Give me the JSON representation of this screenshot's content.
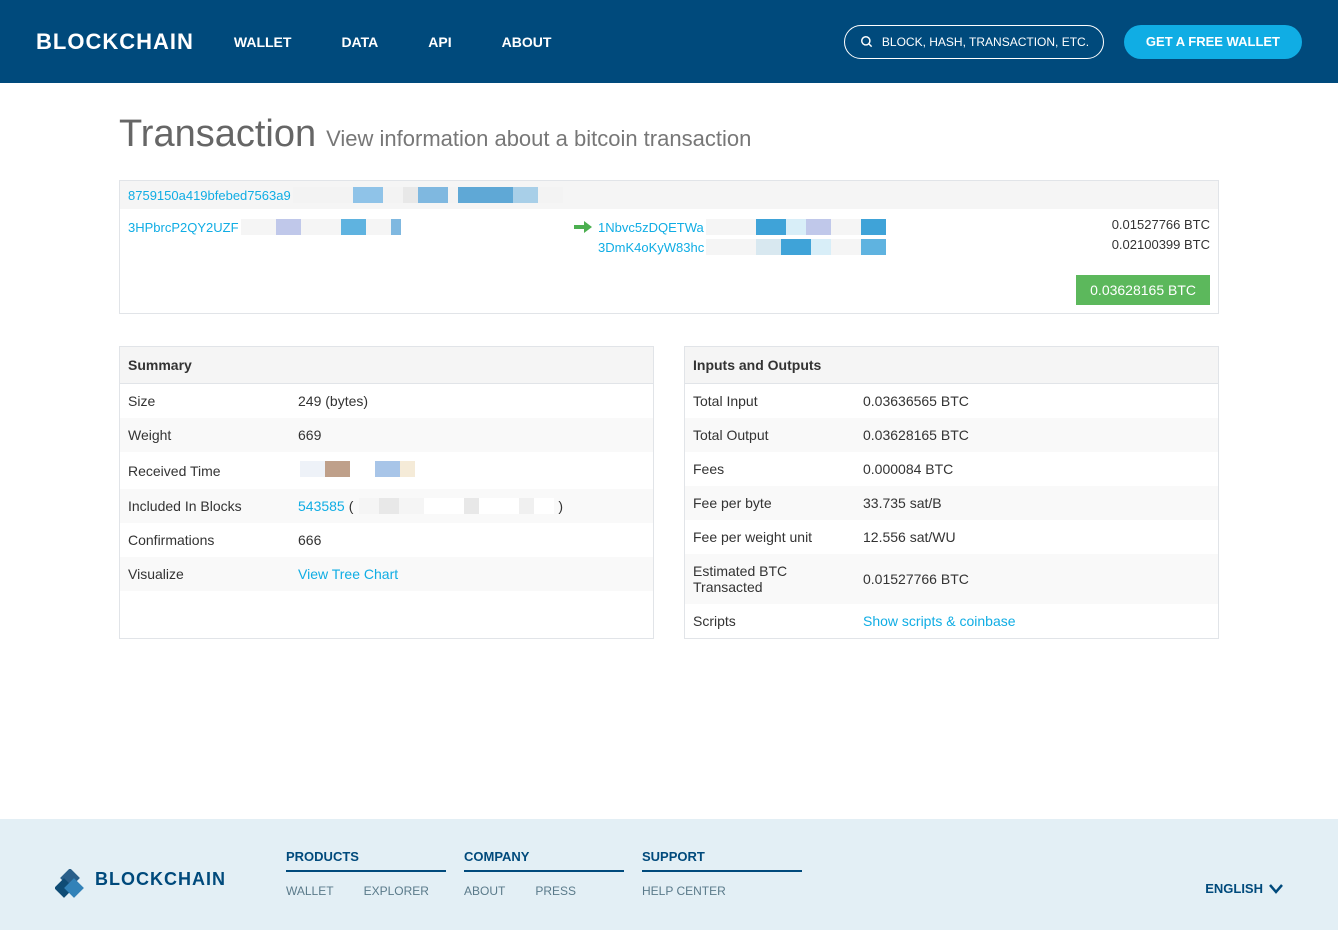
{
  "header": {
    "logo": "BLOCKCHAIN",
    "nav": [
      "WALLET",
      "DATA",
      "API",
      "ABOUT"
    ],
    "search_placeholder": "BLOCK, HASH, TRANSACTION, ETC...",
    "cta": "GET A FREE WALLET"
  },
  "page": {
    "title": "Transaction",
    "subtitle": "View information about a bitcoin transaction"
  },
  "tx": {
    "hash_visible": "8759150a419bfebed7563a9",
    "input_addr_visible": "3HPbrcP2QY2UZF",
    "outputs": [
      {
        "addr_visible": "1Nbvc5zDQETWa",
        "amount": "0.01527766 BTC"
      },
      {
        "addr_visible": "3DmK4oKyW83hc",
        "amount": "0.02100399 BTC"
      }
    ],
    "total": "0.03628165 BTC"
  },
  "summary": {
    "title": "Summary",
    "rows": {
      "size_label": "Size",
      "size_value": "249 (bytes)",
      "weight_label": "Weight",
      "weight_value": "669",
      "received_label": "Received Time",
      "included_label": "Included In Blocks",
      "included_link": "543585",
      "included_open": " (",
      "included_close": ")",
      "confirmations_label": "Confirmations",
      "confirmations_value": "666",
      "visualize_label": "Visualize",
      "visualize_link": "View Tree Chart"
    }
  },
  "io": {
    "title": "Inputs and Outputs",
    "rows": [
      {
        "label": "Total Input",
        "value": "0.03636565 BTC"
      },
      {
        "label": "Total Output",
        "value": "0.03628165 BTC"
      },
      {
        "label": "Fees",
        "value": "0.000084 BTC"
      },
      {
        "label": "Fee per byte",
        "value": "33.735 sat/B"
      },
      {
        "label": "Fee per weight unit",
        "value": "12.556 sat/WU"
      },
      {
        "label": "Estimated BTC Transacted",
        "value": "0.01527766 BTC"
      }
    ],
    "scripts_label": "Scripts",
    "scripts_link": "Show scripts & coinbase"
  },
  "footer": {
    "logo": "BLOCKCHAIN",
    "groups": [
      {
        "heading": "PRODUCTS",
        "cols": [
          [
            "WALLET"
          ],
          [
            "EXPLORER"
          ]
        ]
      },
      {
        "heading": "COMPANY",
        "cols": [
          [
            "ABOUT"
          ],
          [
            "PRESS"
          ]
        ]
      },
      {
        "heading": "SUPPORT",
        "cols": [
          [
            "HELP CENTER"
          ]
        ]
      }
    ],
    "language": "ENGLISH"
  }
}
